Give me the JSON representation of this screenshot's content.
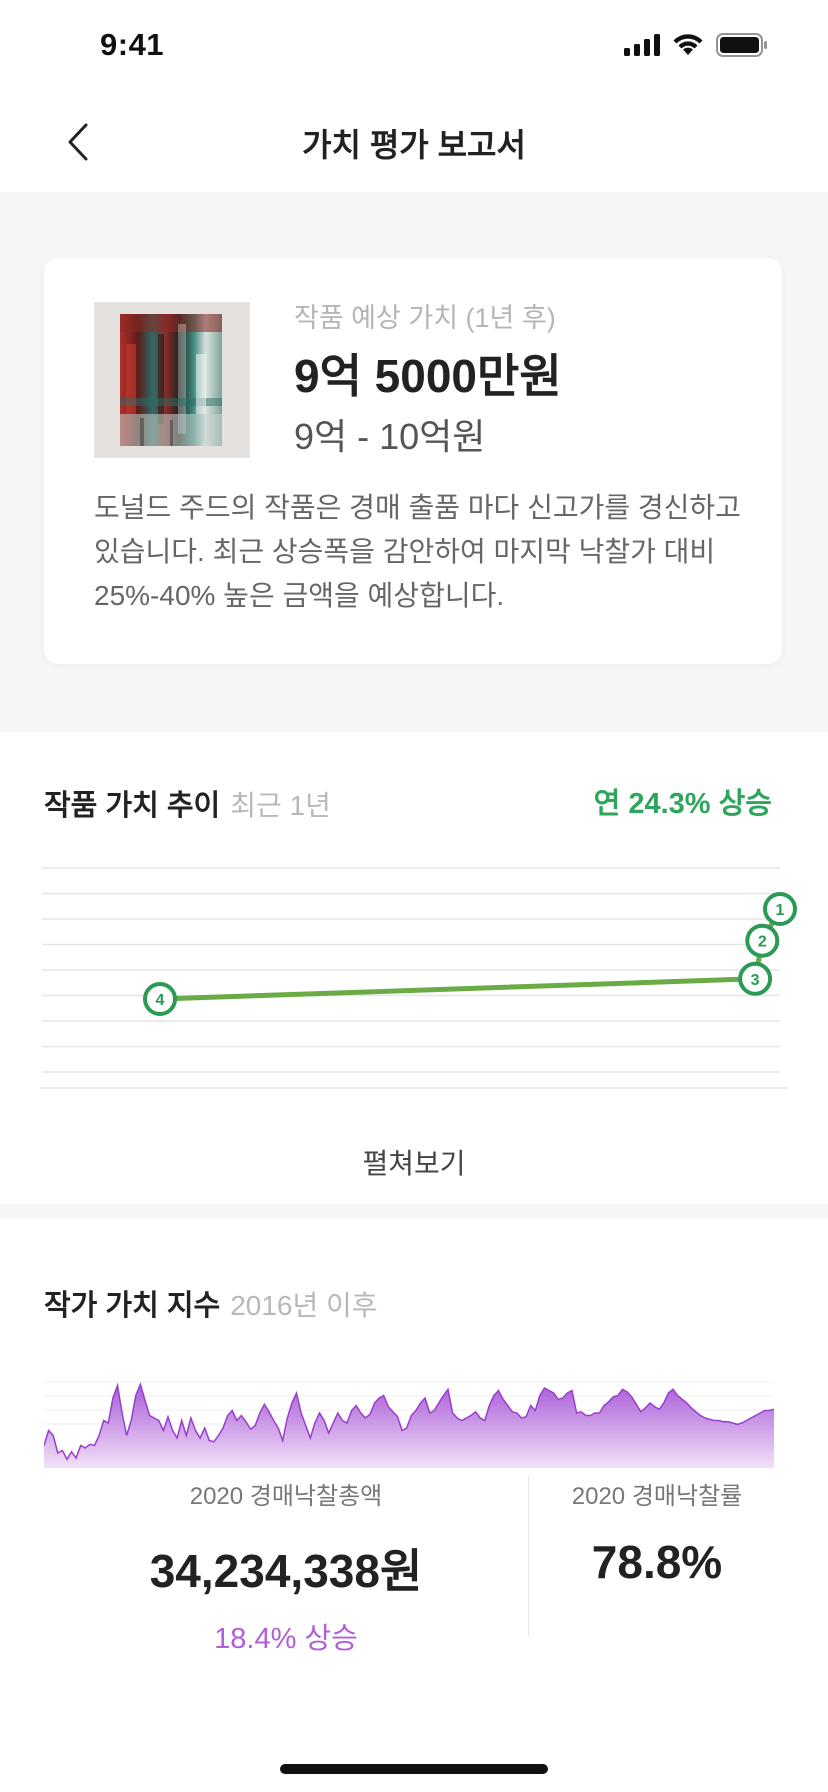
{
  "status_bar": {
    "time": "9:41"
  },
  "nav": {
    "title": "가치 평가 보고서"
  },
  "valuation": {
    "label": "작품 예상 가치 (1년 후)",
    "value": "9억 5000만원",
    "range": "9억 - 10억원",
    "description": "도널드 주드의 작품은 경매 출품 마다 신고가를 경신하고 있습니다. 최근 상승폭을 감안하여 마지막 낙찰가 대비 25%-40% 높은 금액을 예상합니다."
  },
  "trend_section": {
    "title": "작품 가치  추이",
    "subtitle": "최근 1년",
    "badge": "연 24.3% 상승",
    "expand_label": "펼쳐보기"
  },
  "chart_data": [
    {
      "type": "line",
      "series": [
        {
          "values": [
            {
              "x": 0.0,
              "y": 0.0,
              "marker": "4"
            },
            {
              "x": 0.83,
              "y": 0.17,
              "marker": "3"
            },
            {
              "x": 0.84,
              "y": 0.49,
              "marker": "2"
            },
            {
              "x": 0.87,
              "y": 0.81,
              "marker": ""
            }
          ]
        }
      ],
      "annotations": [
        "1",
        "2",
        "3",
        "4"
      ],
      "grid": true,
      "ylim": [
        0,
        1
      ],
      "colors": {
        "line": "#6bab45",
        "marker": "#2a9a55"
      }
    },
    {
      "type": "area",
      "values": [
        18,
        30,
        26,
        12,
        14,
        7,
        13,
        8,
        18,
        16,
        19,
        18,
        26,
        38,
        36,
        56,
        66,
        44,
        26,
        38,
        58,
        67,
        54,
        42,
        40,
        38,
        30,
        41,
        30,
        24,
        38,
        26,
        40,
        30,
        24,
        32,
        22,
        21,
        26,
        32,
        42,
        46,
        38,
        42,
        37,
        31,
        34,
        44,
        51,
        45,
        38,
        32,
        22,
        40,
        52,
        60,
        44,
        34,
        24,
        36,
        44,
        38,
        28,
        36,
        44,
        38,
        36,
        46,
        50,
        44,
        40,
        43,
        52,
        56,
        58,
        49,
        45,
        41,
        30,
        32,
        42,
        46,
        52,
        56,
        44,
        46,
        52,
        58,
        63,
        44,
        40,
        38,
        40,
        42,
        45,
        40,
        38,
        50,
        58,
        62,
        55,
        50,
        45,
        44,
        40,
        41,
        50,
        46,
        58,
        64,
        62,
        60,
        55,
        56,
        60,
        62,
        44,
        45,
        42,
        42,
        44,
        44,
        50,
        53,
        57,
        58,
        63,
        61,
        57,
        51,
        45,
        48,
        52,
        49,
        47,
        52,
        60,
        63,
        58,
        55,
        52,
        48,
        45,
        42,
        40,
        39,
        38,
        38,
        37,
        37,
        36,
        35,
        36,
        38,
        40,
        42,
        44,
        46,
        46,
        47
      ],
      "colors": {
        "fill_top": "#a654d6",
        "fill_bottom": "#f0e0f8",
        "stroke": "#9a3ecc"
      },
      "grid": true,
      "ylim": [
        0,
        80
      ]
    }
  ],
  "index_section": {
    "title": "작가 가치 지수",
    "subtitle": "2016년 이후",
    "stat_left": {
      "label": "2020 경매낙찰총액",
      "value": "34,234,338원",
      "change": "18.4% 상승"
    },
    "stat_right": {
      "label": "2020 경매낙찰률",
      "value": "78.8%"
    }
  }
}
